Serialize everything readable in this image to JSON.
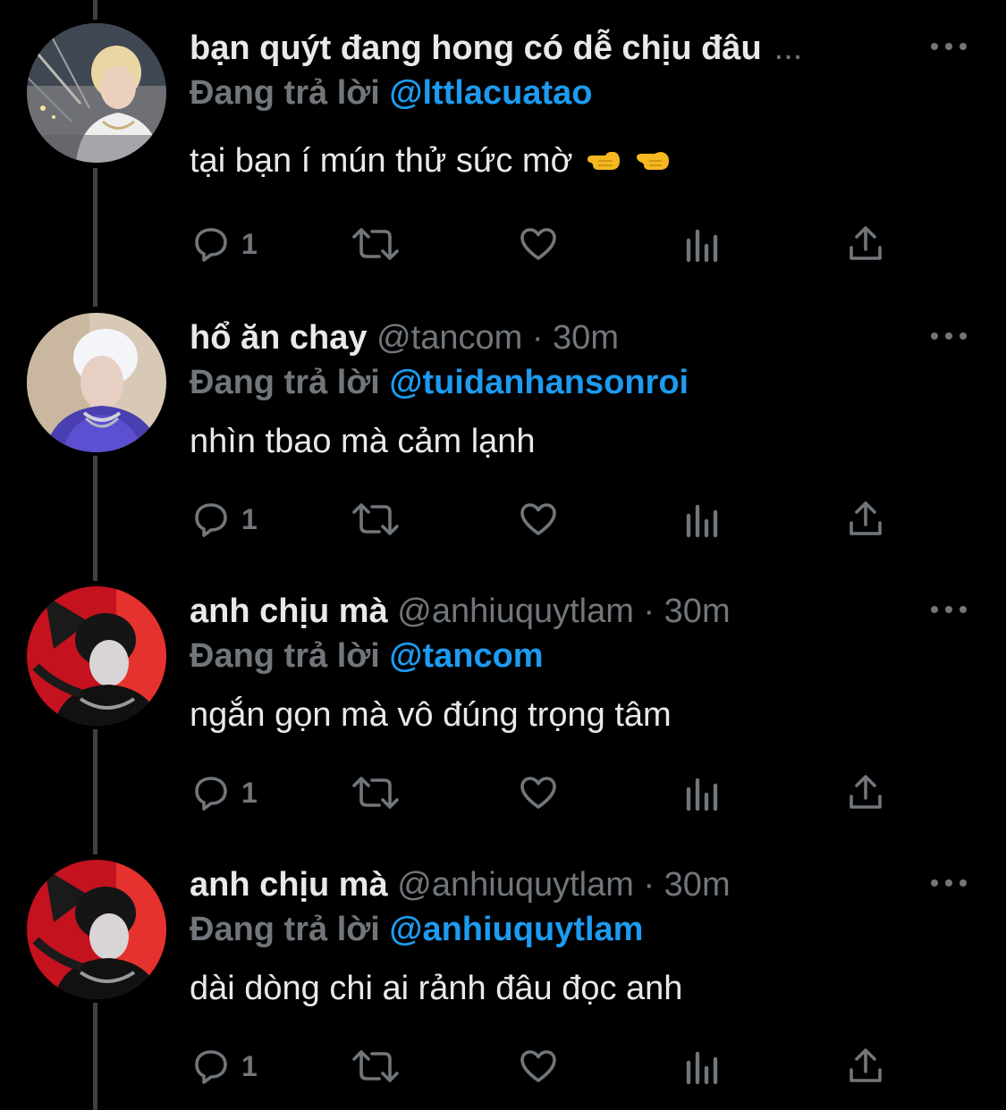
{
  "colors": {
    "background": "#000000",
    "text": "#e7e9ea",
    "muted": "#71767b",
    "link": "#1d9bf0",
    "thread_line": "#3d4146"
  },
  "tweets": [
    {
      "display_name": "bạn quýt đang hong có dễ chịu đâu",
      "handle": "",
      "separator": "",
      "time": "",
      "truncation": "...",
      "reply_prefix": "Đang trả lời",
      "reply_to": "@lttlacuatao",
      "text": "tại bạn í mún thử sức mờ",
      "emojis": [
        "backhand-index-pointing-left-emoji",
        "backhand-index-pointing-left-emoji"
      ],
      "reply_count": "1",
      "avatar": "avatar-blonde-man-night-bridge"
    },
    {
      "display_name": "hổ ăn chay",
      "handle": "@tancom",
      "separator": "·",
      "time": "30m",
      "truncation": "",
      "reply_prefix": "Đang trả lời",
      "reply_to": "@tuidanhansonroi",
      "text": "nhìn tbao mà cảm lạnh",
      "emojis": [],
      "reply_count": "1",
      "avatar": "avatar-white-hair-blue-light"
    },
    {
      "display_name": "anh chịu mà",
      "handle": "@anhiuquytlam",
      "separator": "·",
      "time": "30m",
      "truncation": "",
      "reply_prefix": "Đang trả lời",
      "reply_to": "@tancom",
      "text": "ngắn gọn mà vô đúng trọng tâm",
      "emojis": [],
      "reply_count": "1",
      "avatar": "avatar-dark-hair-red-background"
    },
    {
      "display_name": "anh chịu mà",
      "handle": "@anhiuquytlam",
      "separator": "·",
      "time": "30m",
      "truncation": "",
      "reply_prefix": "Đang trả lời",
      "reply_to": "@anhiuquytlam",
      "text": "dài dòng chi ai rảnh đâu đọc anh",
      "emojis": [],
      "reply_count": "1",
      "avatar": "avatar-dark-hair-red-background"
    }
  ]
}
